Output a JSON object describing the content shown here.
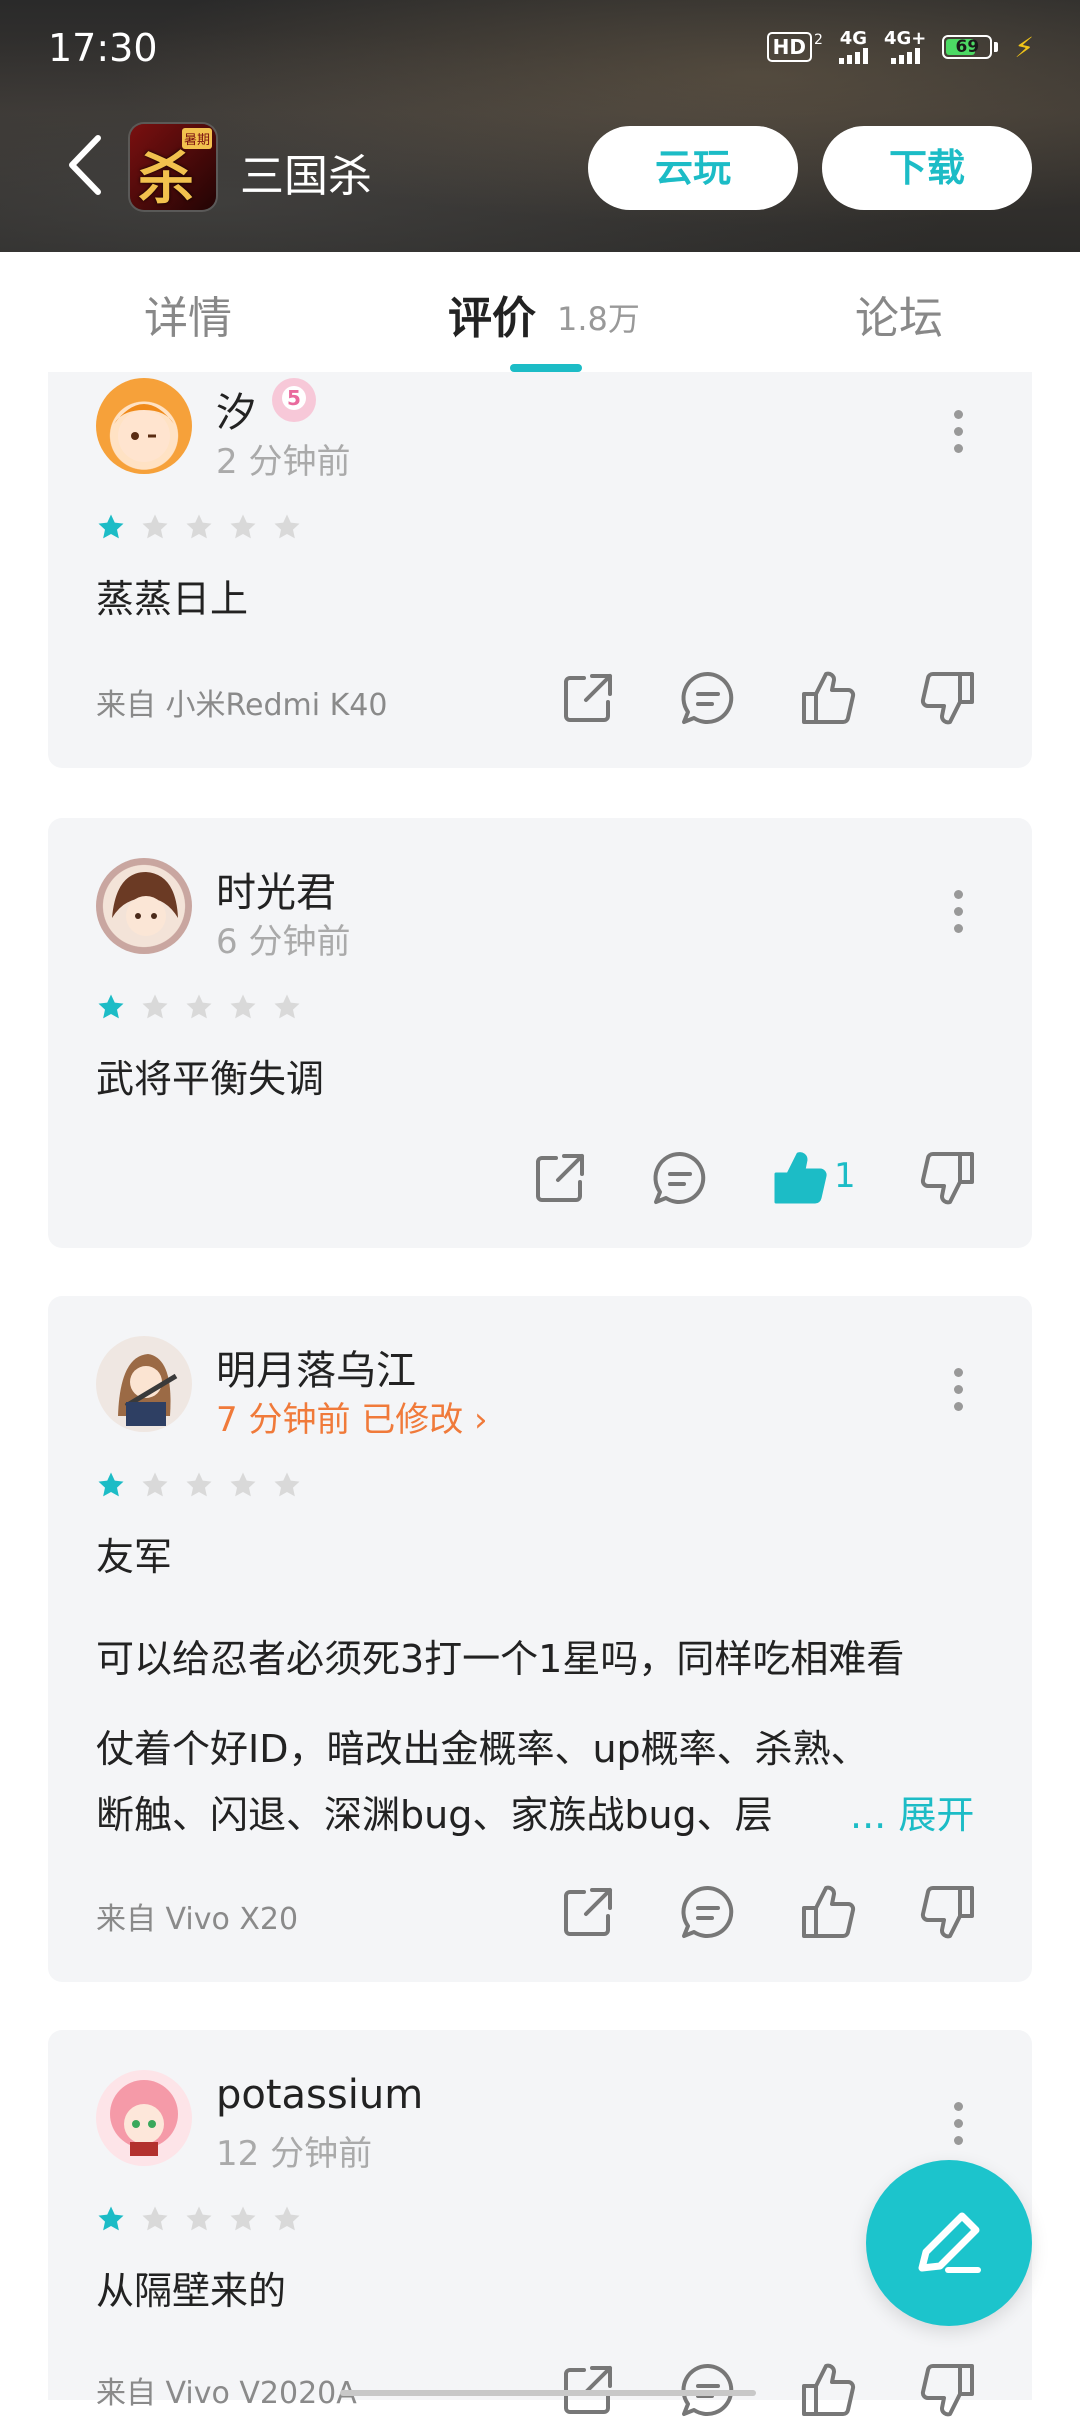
{
  "status_bar": {
    "time": "17:30",
    "hd": "HD",
    "hd_sub": "2",
    "net1": "4G",
    "net2": "4G+",
    "battery": "69",
    "battery_level": 0.69
  },
  "app_header": {
    "back_icon": "chevron-left-icon",
    "app_name": "三国杀",
    "icon_glyph": "杀",
    "icon_tag": "暑期",
    "cloud_play_label": "云玩",
    "download_label": "下载"
  },
  "tabs": {
    "detail": "详情",
    "reviews": "评价",
    "reviews_count": "1.8万",
    "forum": "论坛",
    "active": "reviews"
  },
  "colors": {
    "accent": "#1cbcc6",
    "orange": "#f07a3a",
    "star_on": "#1cbcc6",
    "star_off": "#d9d9d9"
  },
  "reviews": [
    {
      "user": "汐",
      "badge": "5",
      "time": "2 分钟前",
      "rating": 1,
      "text": "蒸蒸日上",
      "device": "来自 小米Redmi K40",
      "like_count": ""
    },
    {
      "user": "时光君",
      "time": "6 分钟前",
      "rating": 1,
      "text": "武将平衡失调",
      "device": "",
      "like_count": "1",
      "liked": true
    },
    {
      "user": "明月落乌江",
      "time": "7 分钟前 已修改 ›",
      "rating": 1,
      "title": "友军",
      "line1": "可以给忍者必须死3打一个1星吗，同样吃相难看",
      "line2": "仗着个好ID，暗改出金概率、up概率、杀熟、",
      "line3": "断触、闪退、深渊bug、家族战bug、层",
      "expand": "... 展开",
      "device": "来自 Vivo X20"
    },
    {
      "user": "potassium",
      "time": "12 分钟前",
      "rating": 1,
      "text": "从隔壁来的",
      "device": "来自 Vivo V2020A"
    }
  ],
  "fab": {
    "icon": "pen-icon"
  }
}
